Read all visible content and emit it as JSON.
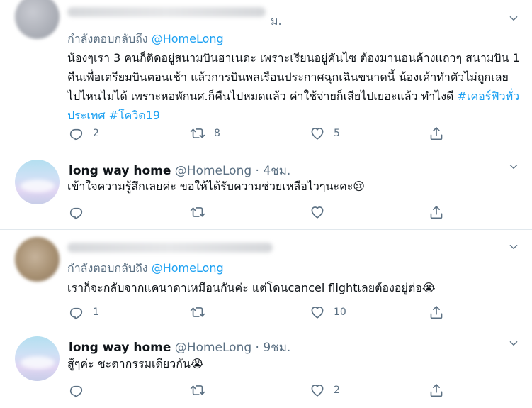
{
  "tweets": [
    {
      "suffix": "ม.",
      "replying_prefix": "กำลังตอบกลับถึง",
      "mention": "@HomeLong",
      "text": "น้องๆเรา 3 คนก็ติดอยู่สนามบินฮาเนดะ เพราะเรียนอยู่คันไซ ต้องมานอนค้างแถวๆ สนามบิน 1 คืนเพื่อเตรียมบินตอนเช้า แล้วการบินพลเรือนประกาศฉุกเฉินขนาดนี้ น้องเค้าทำตัวไม่ถูกเลย ไปไหนไม่ได้ เพราะหอพักนศ.ก็คืนไปหมดแล้ว ค่าใช้จ่ายก็เสียไปเยอะแล้ว ทำไงดี ",
      "hashtag1": "#เคอร์ฟิวทั่วประเทศ",
      "hashtag2": "#โควิด19",
      "reply_count": "2",
      "retweet_count": "8",
      "like_count": "5"
    },
    {
      "name": "long way home",
      "handle": "@HomeLong",
      "dot": "·",
      "time": "4ชม.",
      "text": "เข้าใจความรู้สึกเลยค่ะ ขอให้ได้รับความช่วยเหลือไวๆนะคะ😢",
      "reply_count": "",
      "retweet_count": "",
      "like_count": ""
    },
    {
      "replying_prefix": "กำลังตอบกลับถึง",
      "mention": "@HomeLong",
      "text": "เราก็จะกลับจากแคนาดาเหมือนกันค่ะ แต่โดนcancel flightเลยต้องอยู่ต่อ😭",
      "reply_count": "1",
      "retweet_count": "",
      "like_count": "10"
    },
    {
      "name": "long way home",
      "handle": "@HomeLong",
      "dot": "·",
      "time": "9ชม.",
      "text": "สู้ๆค่ะ ชะตากรรมเดียวกัน😭",
      "reply_count": "",
      "retweet_count": "",
      "like_count": "2"
    }
  ],
  "icons": {
    "reply": "reply-icon",
    "retweet": "retweet-icon",
    "like": "heart-icon",
    "share": "share-icon",
    "more": "chevron-down-icon"
  },
  "colors": {
    "link": "#1da1f2",
    "muted": "#5b7083",
    "text": "#0f1419",
    "divider": "#e1e8ed"
  }
}
